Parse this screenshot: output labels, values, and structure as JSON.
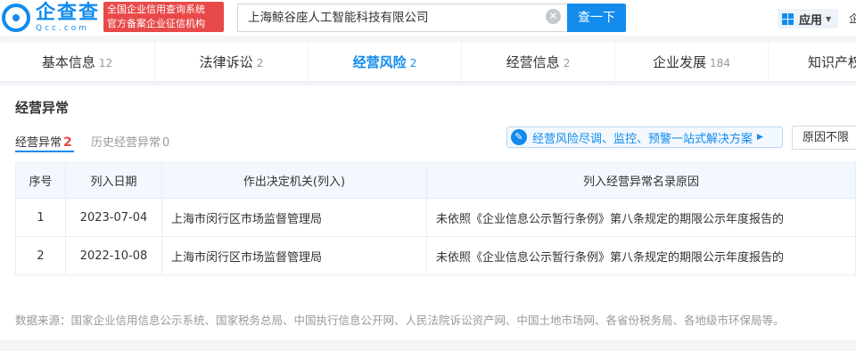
{
  "header": {
    "logo_cn": "企查查",
    "logo_en": "Qcc.com",
    "badge_line1": "全国企业信用查询系统",
    "badge_line2": "官方备案企业征信机构",
    "search_value": "上海鲸谷座人工智能科技有限公司",
    "search_button": "查一下",
    "app_label": "应用",
    "edge_text": "企"
  },
  "tabs": [
    {
      "label": "基本信息",
      "count": "12"
    },
    {
      "label": "法律诉讼",
      "count": "2"
    },
    {
      "label": "经营风险",
      "count": "2"
    },
    {
      "label": "经营信息",
      "count": "2"
    },
    {
      "label": "企业发展",
      "count": "184"
    },
    {
      "label": "知识产权",
      "count": ""
    }
  ],
  "section": {
    "title": "经营异常",
    "subtabs": [
      {
        "label": "经营异常",
        "count": "2"
      },
      {
        "label": "历史经营异常",
        "count": "0"
      }
    ],
    "promo_text": "经营风险尽调、监控、预警一站式解决方案",
    "filter_label": "原因不限"
  },
  "table": {
    "headers": [
      "序号",
      "列入日期",
      "作出决定机关(列入)",
      "列入经营异常名录原因"
    ],
    "rows": [
      [
        "1",
        "2023-07-04",
        "上海市闵行区市场监督管理局",
        "未依照《企业信息公示暂行条例》第八条规定的期限公示年度报告的"
      ],
      [
        "2",
        "2022-10-08",
        "上海市闵行区市场监督管理局",
        "未依照《企业信息公示暂行条例》第八条规定的期限公示年度报告的"
      ]
    ]
  },
  "footer": "数据来源：国家企业信用信息公示系统、国家税务总局、中国执行信息公开网、人民法院诉讼资产网、中国土地市场网、各省份税务局、各地级市环保局等。",
  "colors": {
    "brand": "#128bed",
    "alert": "#e84a4a"
  }
}
